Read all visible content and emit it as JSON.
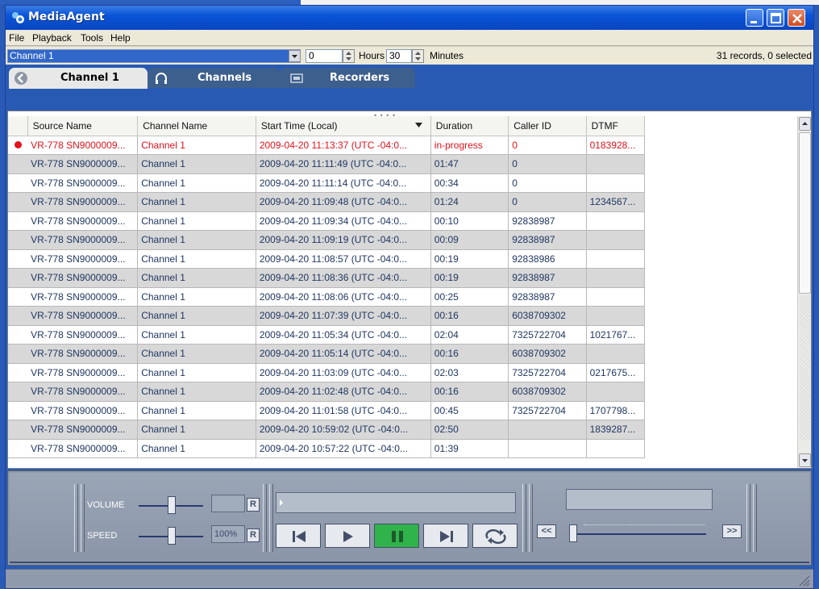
{
  "app": {
    "title": "MediaAgent"
  },
  "menu": [
    "File",
    "Playback",
    "Tools",
    "Help"
  ],
  "tabs": [
    {
      "label": "Channel 1",
      "icon": "back-arrow-icon",
      "active": true
    },
    {
      "label": "Channels",
      "icon": "headphones-icon",
      "active": false
    },
    {
      "label": "Recorders",
      "icon": "recorder-icon",
      "active": false
    }
  ],
  "toolbar": {
    "channel_select": "Channel 1",
    "hours_value": "0",
    "hours_label": "Hours",
    "minutes_value": "30",
    "minutes_label": "Minutes",
    "records_status": "31 records, 0 selected"
  },
  "table": {
    "columns": [
      "Source Name",
      "Channel Name",
      "Start Time (Local)",
      "Duration",
      "Caller ID",
      "DTMF"
    ],
    "sort_column": "Start Time (Local)",
    "rows": [
      {
        "live": true,
        "source": "VR-778 SN9000009...",
        "channel": "Channel 1",
        "start": "2009-04-20 11:13:37 (UTC -04:0...",
        "duration": "in-progress",
        "caller": "0",
        "dtmf": "0183928..."
      },
      {
        "live": false,
        "source": "VR-778 SN9000009...",
        "channel": "Channel 1",
        "start": "2009-04-20 11:11:49 (UTC -04:0...",
        "duration": "01:47",
        "caller": "0",
        "dtmf": ""
      },
      {
        "live": false,
        "source": "VR-778 SN9000009...",
        "channel": "Channel 1",
        "start": "2009-04-20 11:11:14 (UTC -04:0...",
        "duration": "00:34",
        "caller": "0",
        "dtmf": ""
      },
      {
        "live": false,
        "source": "VR-778 SN9000009...",
        "channel": "Channel 1",
        "start": "2009-04-20 11:09:48 (UTC -04:0...",
        "duration": "01:24",
        "caller": "0",
        "dtmf": "1234567..."
      },
      {
        "live": false,
        "source": "VR-778 SN9000009...",
        "channel": "Channel 1",
        "start": "2009-04-20 11:09:34 (UTC -04:0...",
        "duration": "00:10",
        "caller": "92838987",
        "dtmf": ""
      },
      {
        "live": false,
        "source": "VR-778 SN9000009...",
        "channel": "Channel 1",
        "start": "2009-04-20 11:09:19 (UTC -04:0...",
        "duration": "00:09",
        "caller": "92838987",
        "dtmf": ""
      },
      {
        "live": false,
        "source": "VR-778 SN9000009...",
        "channel": "Channel 1",
        "start": "2009-04-20 11:08:57 (UTC -04:0...",
        "duration": "00:19",
        "caller": "92838986",
        "dtmf": ""
      },
      {
        "live": false,
        "source": "VR-778 SN9000009...",
        "channel": "Channel 1",
        "start": "2009-04-20 11:08:36 (UTC -04:0...",
        "duration": "00:19",
        "caller": "92838987",
        "dtmf": ""
      },
      {
        "live": false,
        "source": "VR-778 SN9000009...",
        "channel": "Channel 1",
        "start": "2009-04-20 11:08:06 (UTC -04:0...",
        "duration": "00:25",
        "caller": "92838987",
        "dtmf": ""
      },
      {
        "live": false,
        "source": "VR-778 SN9000009...",
        "channel": "Channel 1",
        "start": "2009-04-20 11:07:39 (UTC -04:0...",
        "duration": "00:16",
        "caller": "6038709302",
        "dtmf": ""
      },
      {
        "live": false,
        "source": "VR-778 SN9000009...",
        "channel": "Channel 1",
        "start": "2009-04-20 11:05:34 (UTC -04:0...",
        "duration": "02:04",
        "caller": "7325722704",
        "dtmf": "1021767..."
      },
      {
        "live": false,
        "source": "VR-778 SN9000009...",
        "channel": "Channel 1",
        "start": "2009-04-20 11:05:14 (UTC -04:0...",
        "duration": "00:16",
        "caller": "6038709302",
        "dtmf": ""
      },
      {
        "live": false,
        "source": "VR-778 SN9000009...",
        "channel": "Channel 1",
        "start": "2009-04-20 11:03:09 (UTC -04:0...",
        "duration": "02:03",
        "caller": "7325722704",
        "dtmf": "0217675..."
      },
      {
        "live": false,
        "source": "VR-778 SN9000009...",
        "channel": "Channel 1",
        "start": "2009-04-20 11:02:48 (UTC -04:0...",
        "duration": "00:16",
        "caller": "6038709302",
        "dtmf": ""
      },
      {
        "live": false,
        "source": "VR-778 SN9000009...",
        "channel": "Channel 1",
        "start": "2009-04-20 11:01:58 (UTC -04:0...",
        "duration": "00:45",
        "caller": "7325722704",
        "dtmf": "1707798..."
      },
      {
        "live": false,
        "source": "VR-778 SN9000009...",
        "channel": "Channel 1",
        "start": "2009-04-20 10:59:02 (UTC -04:0...",
        "duration": "02:50",
        "caller": "",
        "dtmf": "1839287..."
      },
      {
        "live": false,
        "source": "VR-778 SN9000009...",
        "channel": "Channel 1",
        "start": "2009-04-20 10:57:22 (UTC -04:0...",
        "duration": "01:39",
        "caller": "",
        "dtmf": ""
      }
    ]
  },
  "player": {
    "volume_label": "VOLUME",
    "speed_label": "SPEED",
    "volume_value": "",
    "speed_value": "100%",
    "reset_label": "R",
    "rewind_label": "<<",
    "forward_label": ">>"
  },
  "colors": {
    "titlebar": "#0a55d8",
    "live_row": "#e2121b",
    "play_active": "#2fb34a"
  }
}
